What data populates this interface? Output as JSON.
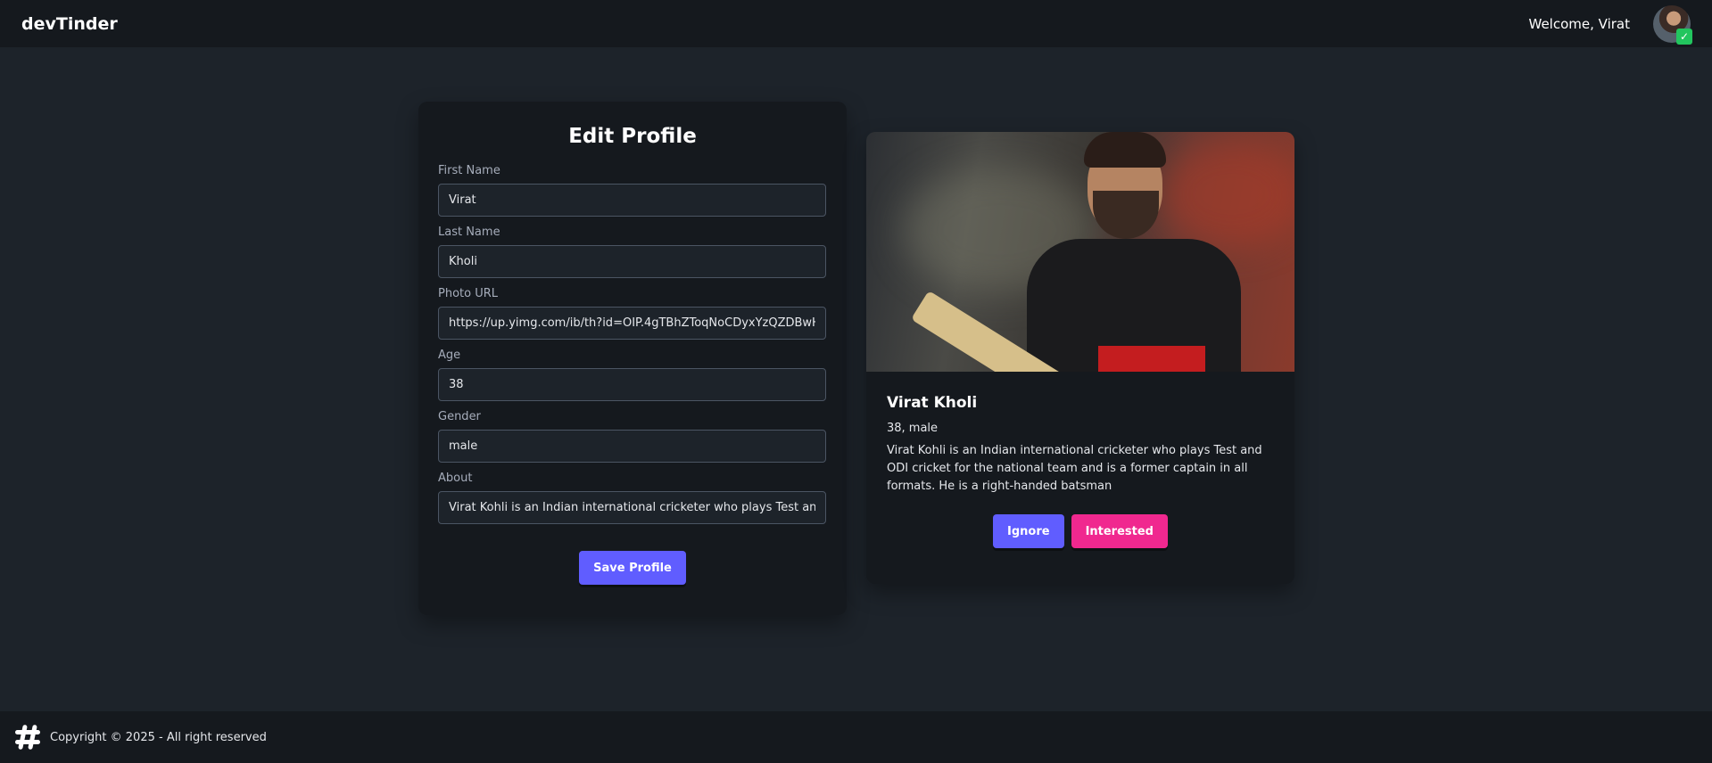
{
  "navbar": {
    "brand": "devTinder",
    "welcome": "Welcome, Virat",
    "online_badge": "✓"
  },
  "edit_form": {
    "title": "Edit Profile",
    "fields": {
      "first_name": {
        "label": "First Name",
        "value": "Virat"
      },
      "last_name": {
        "label": "Last Name",
        "value": "Kholi"
      },
      "photo_url": {
        "label": "Photo URL",
        "value": "https://up.yimg.com/ib/th?id=OIP.4gTBhZToqNoCDyxYzQZDBwHaEK&pid=Api"
      },
      "age": {
        "label": "Age",
        "value": "38"
      },
      "gender": {
        "label": "Gender",
        "value": "male"
      },
      "about": {
        "label": "About",
        "value": "Virat Kohli is an Indian international cricketer who plays Test and ODI cricket for the national team and is a former captain in all formats. He is a right-handed batsman"
      }
    },
    "save_label": "Save Profile"
  },
  "profile_card": {
    "name": "Virat Kholi",
    "meta": "38, male",
    "about": "Virat Kohli is an Indian international cricketer who plays Test and ODI cricket for the national team and is a former captain in all formats. He is a right-handed batsman",
    "ignore_label": "Ignore",
    "interested_label": "Interested"
  },
  "footer": {
    "copyright": "Copyright © 2025 - All right reserved",
    "icon": "hashtag-icon"
  },
  "colors": {
    "background": "#1d232a",
    "surface": "#15191e",
    "primary": "#605dff",
    "secondary": "#f0288f",
    "success": "#22c55e"
  }
}
